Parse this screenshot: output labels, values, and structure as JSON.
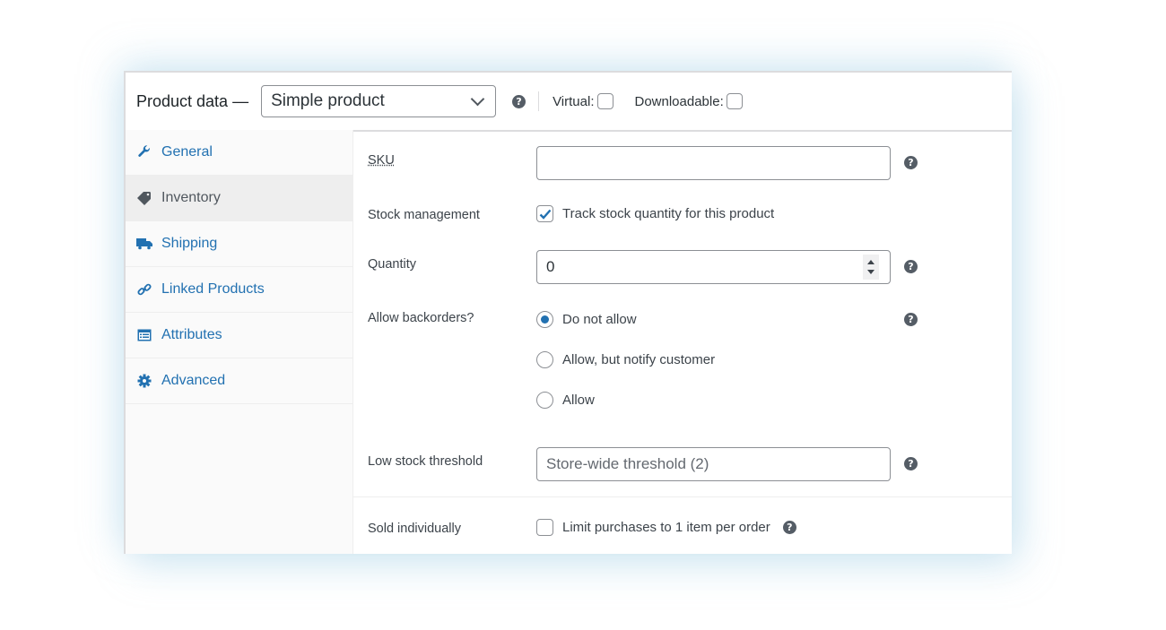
{
  "header": {
    "title": "Product data —",
    "product_type": {
      "selected": "Simple product"
    },
    "help_glyph": "?",
    "virtual": {
      "label": "Virtual:",
      "checked": false
    },
    "downloadable": {
      "label": "Downloadable:",
      "checked": false
    }
  },
  "sidebar": {
    "items": [
      {
        "label": "General",
        "icon": "wrench-icon",
        "active": false
      },
      {
        "label": "Inventory",
        "icon": "tag-icon",
        "active": true
      },
      {
        "label": "Shipping",
        "icon": "truck-icon",
        "active": false
      },
      {
        "label": "Linked Products",
        "icon": "link-icon",
        "active": false
      },
      {
        "label": "Attributes",
        "icon": "list-card-icon",
        "active": false
      },
      {
        "label": "Advanced",
        "icon": "gear-icon",
        "active": false
      }
    ]
  },
  "inventory": {
    "sku": {
      "label": "SKU",
      "value": ""
    },
    "stock_management": {
      "label": "Stock management",
      "option": "Track stock quantity for this product",
      "checked": true
    },
    "quantity": {
      "label": "Quantity",
      "value": "0"
    },
    "backorders": {
      "label": "Allow backorders?",
      "options": [
        "Do not allow",
        "Allow, but notify customer",
        "Allow"
      ],
      "selected": "Do not allow"
    },
    "low_stock": {
      "label": "Low stock threshold",
      "placeholder": "Store-wide threshold (2)"
    },
    "sold_individually": {
      "label": "Sold individually",
      "option": "Limit purchases to 1 item per order",
      "checked": false
    }
  },
  "colors": {
    "accent": "#2271b1",
    "border": "#8c8f94",
    "help_icon": "#555d66"
  }
}
